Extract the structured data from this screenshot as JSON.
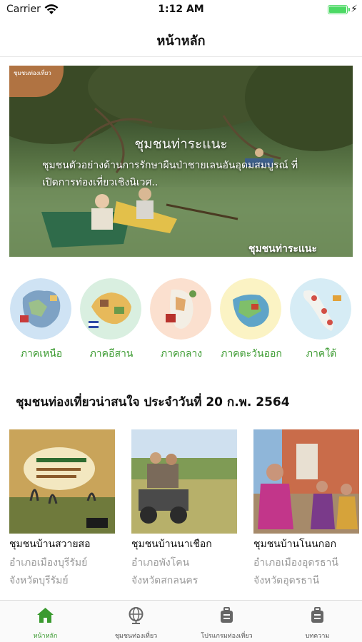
{
  "status_bar": {
    "carrier": "Carrier",
    "time": "1:12 AM",
    "battery_level": 1.0
  },
  "navbar": {
    "title": "หน้าหลัก"
  },
  "hero": {
    "logo_text": "ชุมชนท่องเที่ยว",
    "title": "ชุมชนท่าระแนะ",
    "description": "ชุมชนตัวอย่างด้านการรักษาผืนป่าชายเลนอันอุดมสมบูรณ์ ที่เปิดการท่องเที่ยวเชิงนิเวศ..",
    "caption": "ชุมชนท่าระแนะ"
  },
  "regions": [
    {
      "label": "ภาคเหนือ",
      "icon": "north-region-map-icon",
      "color": "#cfe3f4"
    },
    {
      "label": "ภาคอีสาน",
      "icon": "northeast-region-map-icon",
      "color": "#d9efe0"
    },
    {
      "label": "ภาคกลาง",
      "icon": "central-region-map-icon",
      "color": "#fbe0cf"
    },
    {
      "label": "ภาคตะวันออก",
      "icon": "east-region-map-icon",
      "color": "#fbf3c4"
    },
    {
      "label": "ภาคใต้",
      "icon": "south-region-map-icon",
      "color": "#d6ecf5"
    }
  ],
  "section": {
    "title": "ชุมชนท่องเที่ยวน่าสนใจ ประจำวันที่ 20 ก.พ. 2564"
  },
  "cards": [
    {
      "name": "ชุมชนบ้านสวายสอ",
      "district": "อำเภอเมืองบุรีรัมย์",
      "province": "จังหวัดบุรีรัมย์"
    },
    {
      "name": "ชุมชนบ้านนาเชือก",
      "district": "อำเภอพังโคน",
      "province": "จังหวัดสกลนคร"
    },
    {
      "name": "ชุมชนบ้านโนนกอก",
      "district": "อำเภอเมืองอุดรธานี",
      "province": "จังหวัดอุดรธานี"
    }
  ],
  "tabbar": {
    "tabs": [
      {
        "label": "หน้าหลัก",
        "icon": "home-icon",
        "active": true
      },
      {
        "label": "ชุมชนท่องเที่ยว",
        "icon": "globe-icon",
        "active": false
      },
      {
        "label": "โปรแกรมท่องเที่ยว",
        "icon": "luggage-icon",
        "active": false
      },
      {
        "label": "บทความ",
        "icon": "luggage-icon",
        "active": false
      }
    ],
    "active_color": "#3a9a2f",
    "inactive_color": "#555555"
  }
}
